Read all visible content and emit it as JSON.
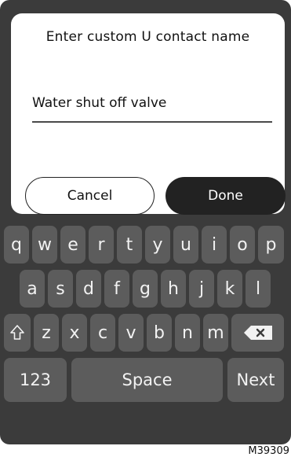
{
  "dialog": {
    "title": "Enter custom U contact name",
    "input_value": "Water shut off valve",
    "cancel_label": "Cancel",
    "done_label": "Done"
  },
  "keyboard": {
    "row1": [
      "q",
      "w",
      "e",
      "r",
      "t",
      "y",
      "u",
      "i",
      "o",
      "p"
    ],
    "row2": [
      "a",
      "s",
      "d",
      "f",
      "g",
      "h",
      "j",
      "k",
      "l"
    ],
    "row3": [
      "z",
      "x",
      "c",
      "v",
      "b",
      "n",
      "m"
    ],
    "shift_icon": "shift-arrow",
    "delete_icon": "backspace-x",
    "numbers_label": "123",
    "space_label": "Space",
    "next_label": "Next"
  },
  "footer": {
    "code": "M39309"
  },
  "colors": {
    "device_bg": "#3b3b3b",
    "key_bg": "#5c5c5c",
    "done_bg": "#222222",
    "dialog_bg": "#ffffff"
  }
}
